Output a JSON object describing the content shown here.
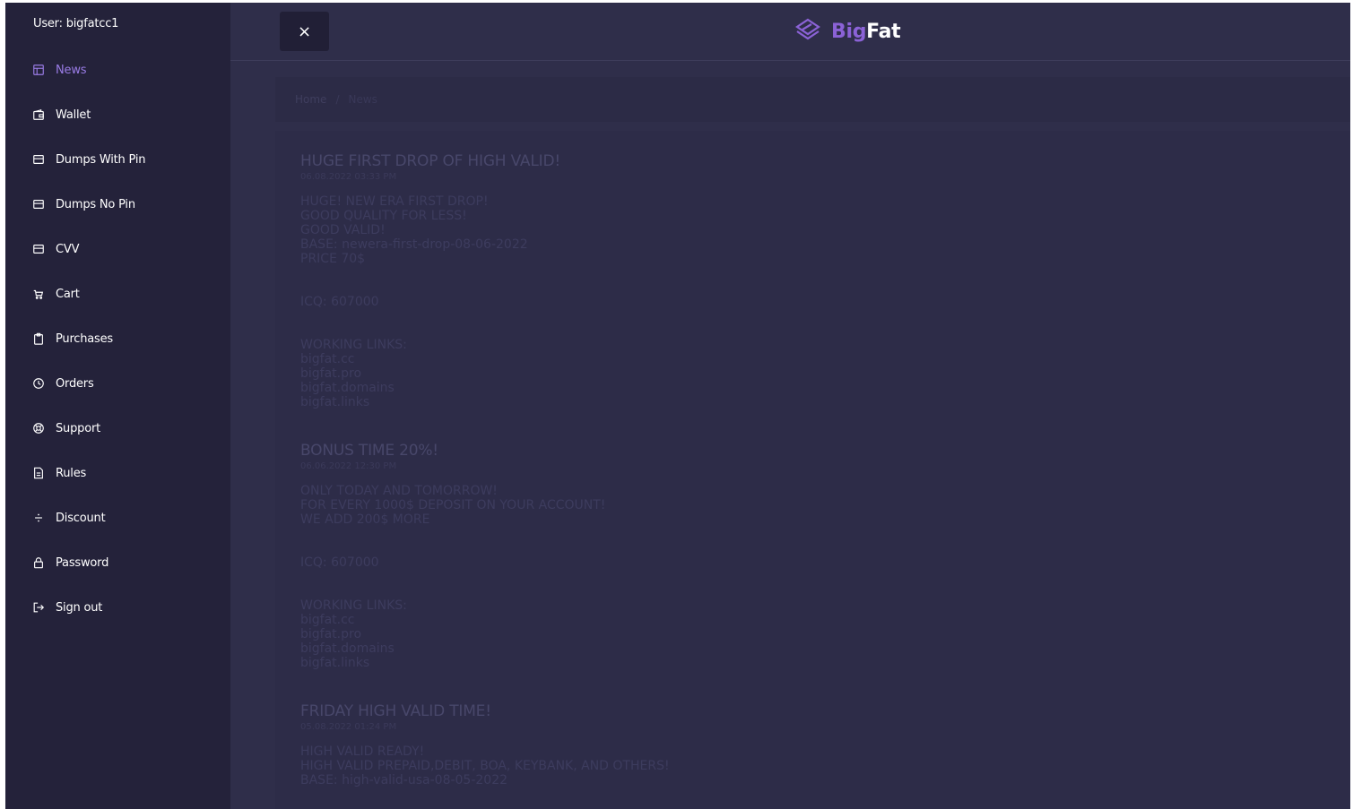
{
  "sidebar": {
    "user_label": "User: bigfatcc1",
    "items": [
      {
        "label": "News",
        "icon": "layout-icon",
        "active": true
      },
      {
        "label": "Wallet",
        "icon": "wallet-icon"
      },
      {
        "label": "Dumps With Pin",
        "icon": "card-icon"
      },
      {
        "label": "Dumps No Pin",
        "icon": "card-icon"
      },
      {
        "label": "CVV",
        "icon": "card-icon"
      },
      {
        "label": "Cart",
        "icon": "cart-icon"
      },
      {
        "label": "Purchases",
        "icon": "clipboard-icon"
      },
      {
        "label": "Orders",
        "icon": "clock-icon"
      },
      {
        "label": "Support",
        "icon": "lifebuoy-icon"
      },
      {
        "label": "Rules",
        "icon": "document-icon"
      },
      {
        "label": "Discount",
        "icon": "divide-icon"
      },
      {
        "label": "Password",
        "icon": "lock-icon"
      },
      {
        "label": "Sign out",
        "icon": "sign-out-icon"
      }
    ],
    "active_color": "#9a7ce6"
  },
  "header": {
    "close_label": "×",
    "logo_part1": "Big",
    "logo_part2": "Fat",
    "brand_color": "#8b62d6"
  },
  "breadcrumb": {
    "home": "Home",
    "separator": "/",
    "current": "News"
  },
  "posts": [
    {
      "title": "HUGE FIRST DROP OF HIGH VALID!",
      "date": "06.08.2022 03:33 PM",
      "lines": [
        "HUGE! NEW ERA FIRST DROP!",
        "GOOD QUALITY FOR LESS!",
        "GOOD VALID!",
        "BASE: newera-first-drop-08-06-2022",
        "PRICE 70$",
        "",
        "ICQ: 607000",
        "",
        "WORKING LINKS:",
        "bigfat.cc",
        "bigfat.pro",
        "bigfat.domains",
        "bigfat.links"
      ]
    },
    {
      "title": "BONUS TIME 20%!",
      "date": "06.06.2022 12:30 PM",
      "lines": [
        "ONLY TODAY AND TOMORROW!",
        "FOR EVERY 1000$ DEPOSIT ON YOUR ACCOUNT!",
        "WE ADD 200$ MORE",
        "",
        "ICQ: 607000",
        "",
        "WORKING LINKS:",
        "bigfat.cc",
        "bigfat.pro",
        "bigfat.domains",
        "bigfat.links"
      ]
    },
    {
      "title": "FRIDAY HIGH VALID TIME!",
      "date": "05.08.2022 01:24 PM",
      "lines": [
        "HIGH VALID READY!",
        "HIGH VALID PREPAID,DEBIT, BOA, KEYBANK, AND OTHERS!",
        "BASE: high-valid-usa-08-05-2022"
      ]
    }
  ]
}
